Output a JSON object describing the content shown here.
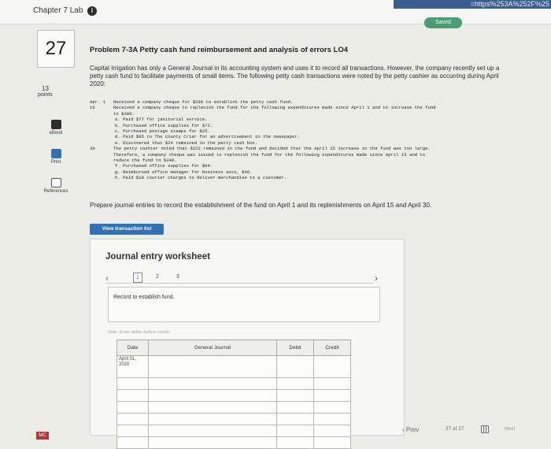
{
  "header": {
    "chapter_title": "Chapter 7 Lab",
    "url_fragment": "=https%253A%252F%25",
    "saved_label": "Saved"
  },
  "question": {
    "number": "27",
    "points_value": "13",
    "points_label": "points"
  },
  "rail": {
    "items": [
      {
        "label": "eBook",
        "icon": "ebook-icon"
      },
      {
        "label": "Print",
        "icon": "print-icon"
      },
      {
        "label": "References",
        "icon": "references-icon"
      }
    ],
    "badge": "MC"
  },
  "problem": {
    "title": "Problem 7-3A Petty cash fund reimbursement and analysis of errors LO4",
    "description": "Capital Irrigation has only a General Journal in its accounting system and uses it to record all transactions. However, the company recently set up a petty cash fund to facilitate payments of small items. The following petty cash transactions were noted by the petty cashier as occurring during April 2020:",
    "transactions": [
      {
        "date": "Apr. 1",
        "text": "Received a company cheque for $290 to establish the petty cash fund.",
        "sub": false
      },
      {
        "date": "15",
        "text": "Received a company cheque to replenish the fund for the following expenditures made since April 1 and to increase the fund",
        "sub": false
      },
      {
        "date": "",
        "text": "to $380.",
        "sub": false
      },
      {
        "date": "",
        "text": "a. Paid $77 for janitorial service.",
        "sub": true
      },
      {
        "date": "",
        "text": "b. Purchased office supplies for $72.",
        "sub": true
      },
      {
        "date": "",
        "text": "c. Purchased postage stamps for $25.",
        "sub": true
      },
      {
        "date": "",
        "text": "d. Paid $95 to The County Crier for an advertisement in the newspaper.",
        "sub": true
      },
      {
        "date": "",
        "text": "e. Discovered that $24 remained in the petty cash box.",
        "sub": true
      },
      {
        "date": "30",
        "text": "The petty cashier noted that $222 remained in the fund and decided that the April 15 increase in the fund was too large.",
        "sub": false
      },
      {
        "date": "",
        "text": "Therefore, a company cheque was issued to replenish the fund for the following expenditures made since April 15 and to",
        "sub": false
      },
      {
        "date": "",
        "text": "reduce the fund to $340.",
        "sub": false
      },
      {
        "date": "",
        "text": "f. Purchased office supplies for $94.",
        "sub": true
      },
      {
        "date": "",
        "text": "g. Reimbursed office manager for business auto, $46.",
        "sub": true
      },
      {
        "date": "",
        "text": "h. Paid $18 courier charges to deliver merchandise to a customer.",
        "sub": true
      }
    ],
    "instruction": "Prepare journal entries to record the establishment of the fund on April 1 and its replenishments on April 15 and April 30."
  },
  "view_transaction_label": "View transaction list",
  "worksheet": {
    "title": "Journal entry worksheet",
    "pages": [
      "1",
      "2",
      "3"
    ],
    "active_page": "1",
    "record_text": "Record to establish fund.",
    "note": "Note: Enter debits before credits.",
    "columns": [
      "Date",
      "General Journal",
      "Debit",
      "Credit"
    ],
    "first_date": "April 01, 2020"
  },
  "footer": {
    "prev_label": "Prev",
    "page_info": "27 of 27",
    "next_label": "Next"
  },
  "colors": {
    "accent_blue": "#2f72b5",
    "saved_green": "#4a9e76",
    "badge_red": "#b03a3a"
  }
}
